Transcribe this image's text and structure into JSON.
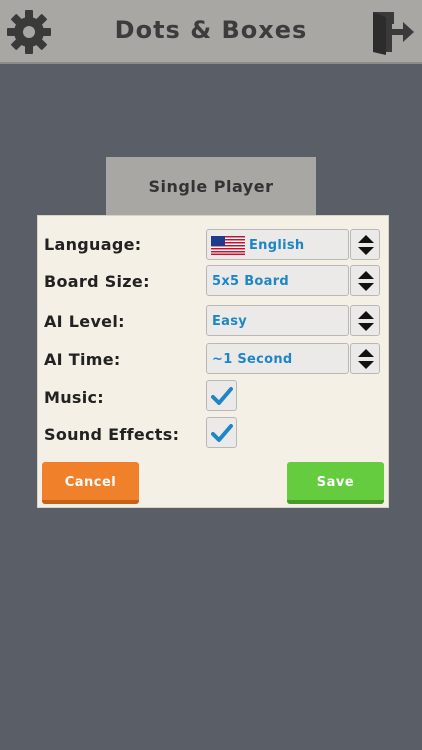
{
  "header": {
    "title": "Dots & Boxes",
    "settings_icon": "gear-icon",
    "exit_icon": "exit-door-icon"
  },
  "background_button": {
    "label": "Single Player"
  },
  "settings": {
    "language": {
      "label": "Language:",
      "value": "English",
      "flag": "us-flag-icon"
    },
    "board_size": {
      "label": "Board Size:",
      "value": "5x5 Board"
    },
    "ai_level": {
      "label": "AI Level:",
      "value": "Easy"
    },
    "ai_time": {
      "label": "AI Time:",
      "value": "~1 Second"
    },
    "music": {
      "label": "Music:",
      "checked": true
    },
    "sound_effects": {
      "label": "Sound Effects:",
      "checked": true
    },
    "cancel_label": "Cancel",
    "save_label": "Save"
  },
  "colors": {
    "accent": "#1e86c6",
    "cancel": "#f0802a",
    "save": "#66cc3f",
    "background": "#5a5e66"
  }
}
